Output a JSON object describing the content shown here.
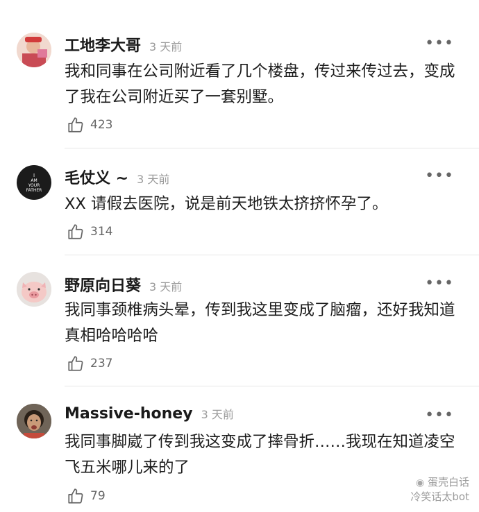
{
  "comments": [
    {
      "username": "工地李大哥",
      "time": "3 天前",
      "more": "•••",
      "text": "我和同事在公司附近看了几个楼盘，传过来传过去，变成了我在公司附近买了一套别墅。",
      "likes": "423"
    },
    {
      "username": "毛仗义 ~",
      "time": "3 天前",
      "more": "•••",
      "text": "XX 请假去医院，说是前天地铁太挤挤怀孕了。",
      "likes": "314",
      "avatar_text": [
        "I",
        "AM",
        "YOUR",
        "FATHER"
      ]
    },
    {
      "username": "野原向日葵",
      "time": "3 天前",
      "more": "•••",
      "text": "我同事颈椎病头晕，传到我这里变成了脑瘤，还好我知道真相哈哈哈哈",
      "likes": "237"
    },
    {
      "username": "Massive-honey",
      "time": "3 天前",
      "more": "•••",
      "text": "我同事脚崴了传到我这变成了摔骨折……我现在知道凌空飞五米哪儿来的了",
      "likes": "79"
    }
  ],
  "watermark": {
    "line1": "蛋壳白话",
    "line2": "冷笑话太bot"
  }
}
